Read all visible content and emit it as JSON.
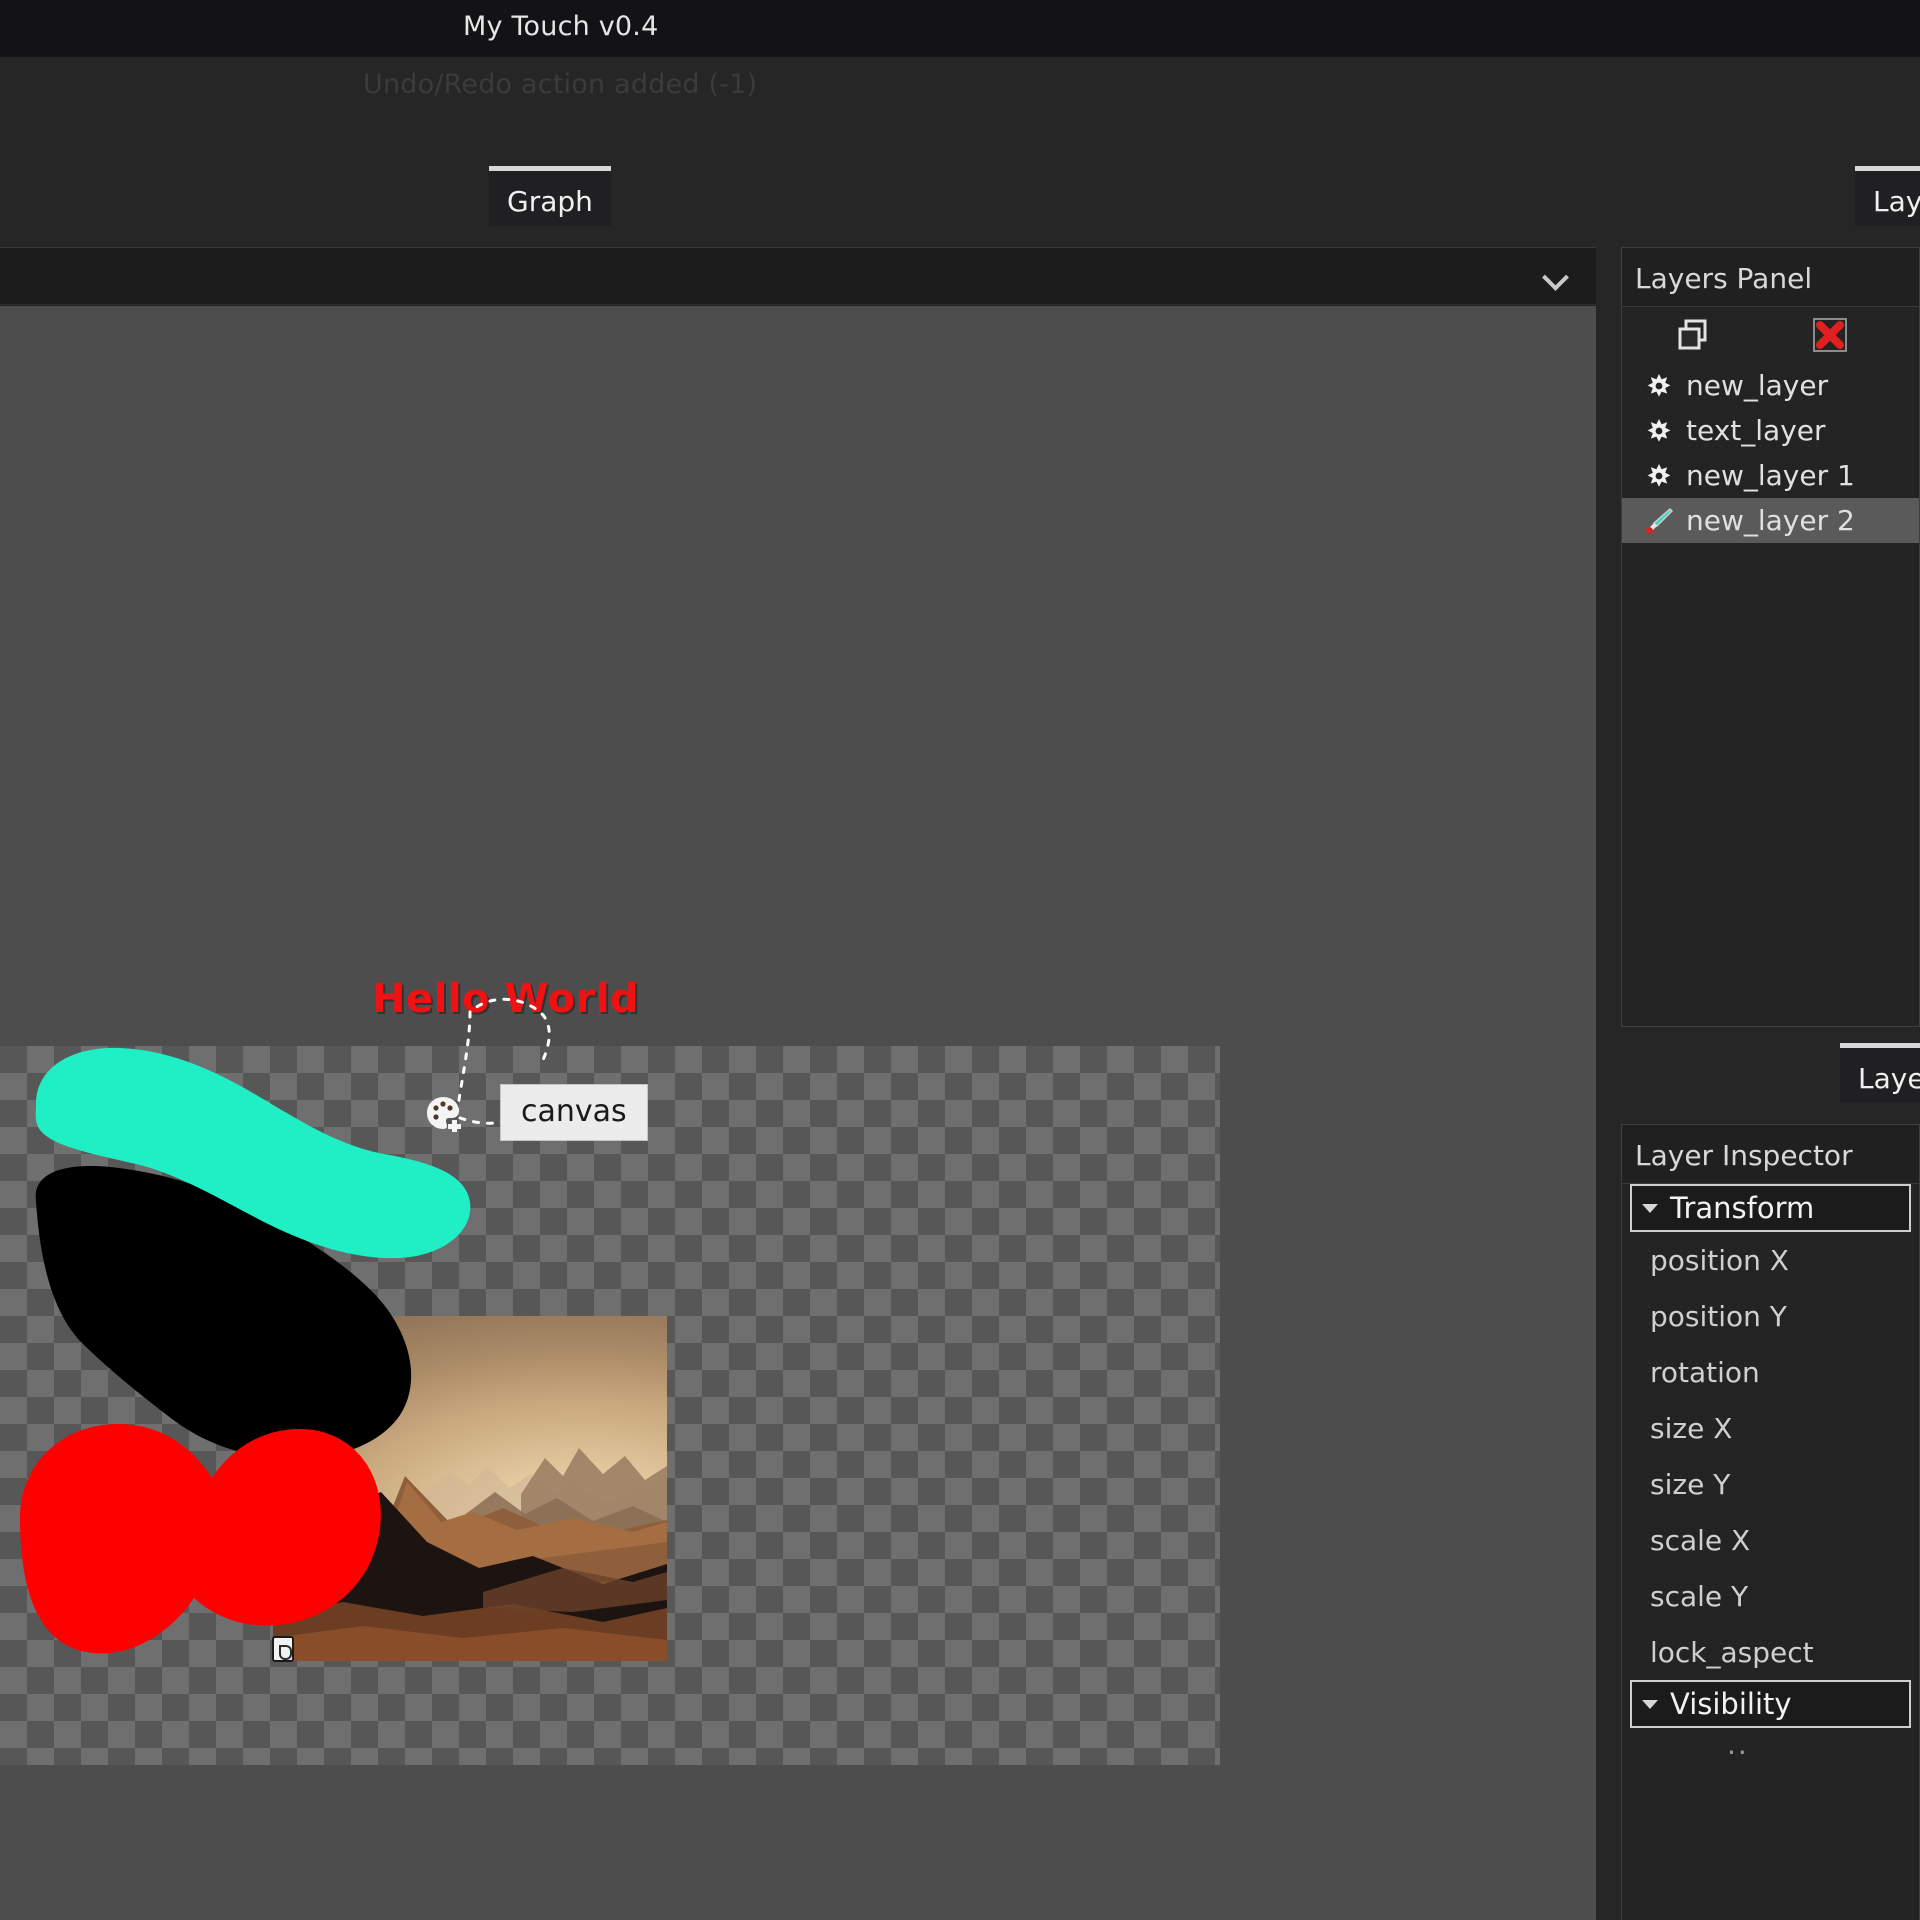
{
  "window": {
    "title": "My Touch v0.4",
    "status_message": "Undo/Redo action added (-1)"
  },
  "graph_tabs": [
    {
      "label": "Graph",
      "active": true
    }
  ],
  "right_tabs_top": [
    {
      "label": "Lay",
      "active": true
    }
  ],
  "right_tabs_bottom": [
    {
      "label": "Layer",
      "active": true
    }
  ],
  "graph_toolbar": {
    "selector_value": "",
    "chevron_icon": "chevron-down-icon"
  },
  "canvas": {
    "text_layer_content": "Hello World",
    "text_layer_color": "#f01212",
    "node_label": "canvas",
    "node_icon": "palette-icon",
    "strokes": [
      {
        "name": "teal-stroke",
        "color": "#20eec4"
      },
      {
        "name": "black-stroke",
        "color": "#000000"
      },
      {
        "name": "red-stroke",
        "color": "#ff0000"
      }
    ],
    "image_layer": {
      "name": "desert-landscape",
      "handle_icon": "resize-handle-icon"
    }
  },
  "layers_panel": {
    "title": "Layers Panel",
    "toolbar": {
      "duplicate_icon": "duplicate-layer-icon",
      "delete_icon": "delete-layer-icon",
      "delete_color": "#e02020"
    },
    "layers": [
      {
        "name": "new_layer",
        "icon": "gear-icon",
        "selected": false
      },
      {
        "name": "text_layer",
        "icon": "gear-icon",
        "selected": false
      },
      {
        "name": "new_layer 1",
        "icon": "gear-icon",
        "selected": false
      },
      {
        "name": "new_layer 2",
        "icon": "brush-icon",
        "selected": true
      }
    ]
  },
  "layer_inspector": {
    "title": "Layer Inspector",
    "groups": [
      {
        "label": "Transform",
        "expanded": true,
        "properties": [
          "position X",
          "position Y",
          "rotation",
          "size X",
          "size Y",
          "scale X",
          "scale Y",
          "lock_aspect"
        ]
      },
      {
        "label": "Visibility",
        "expanded": true,
        "properties": [],
        "ellipsis": ".."
      }
    ]
  },
  "colors": {
    "window_bg": "#262626",
    "titlebar_bg": "#131316",
    "panel_bg": "#202020",
    "canvas_bg": "#4d4d4d",
    "selected_row": "#5a5a5a",
    "accent_text": "#e6e6e6"
  }
}
